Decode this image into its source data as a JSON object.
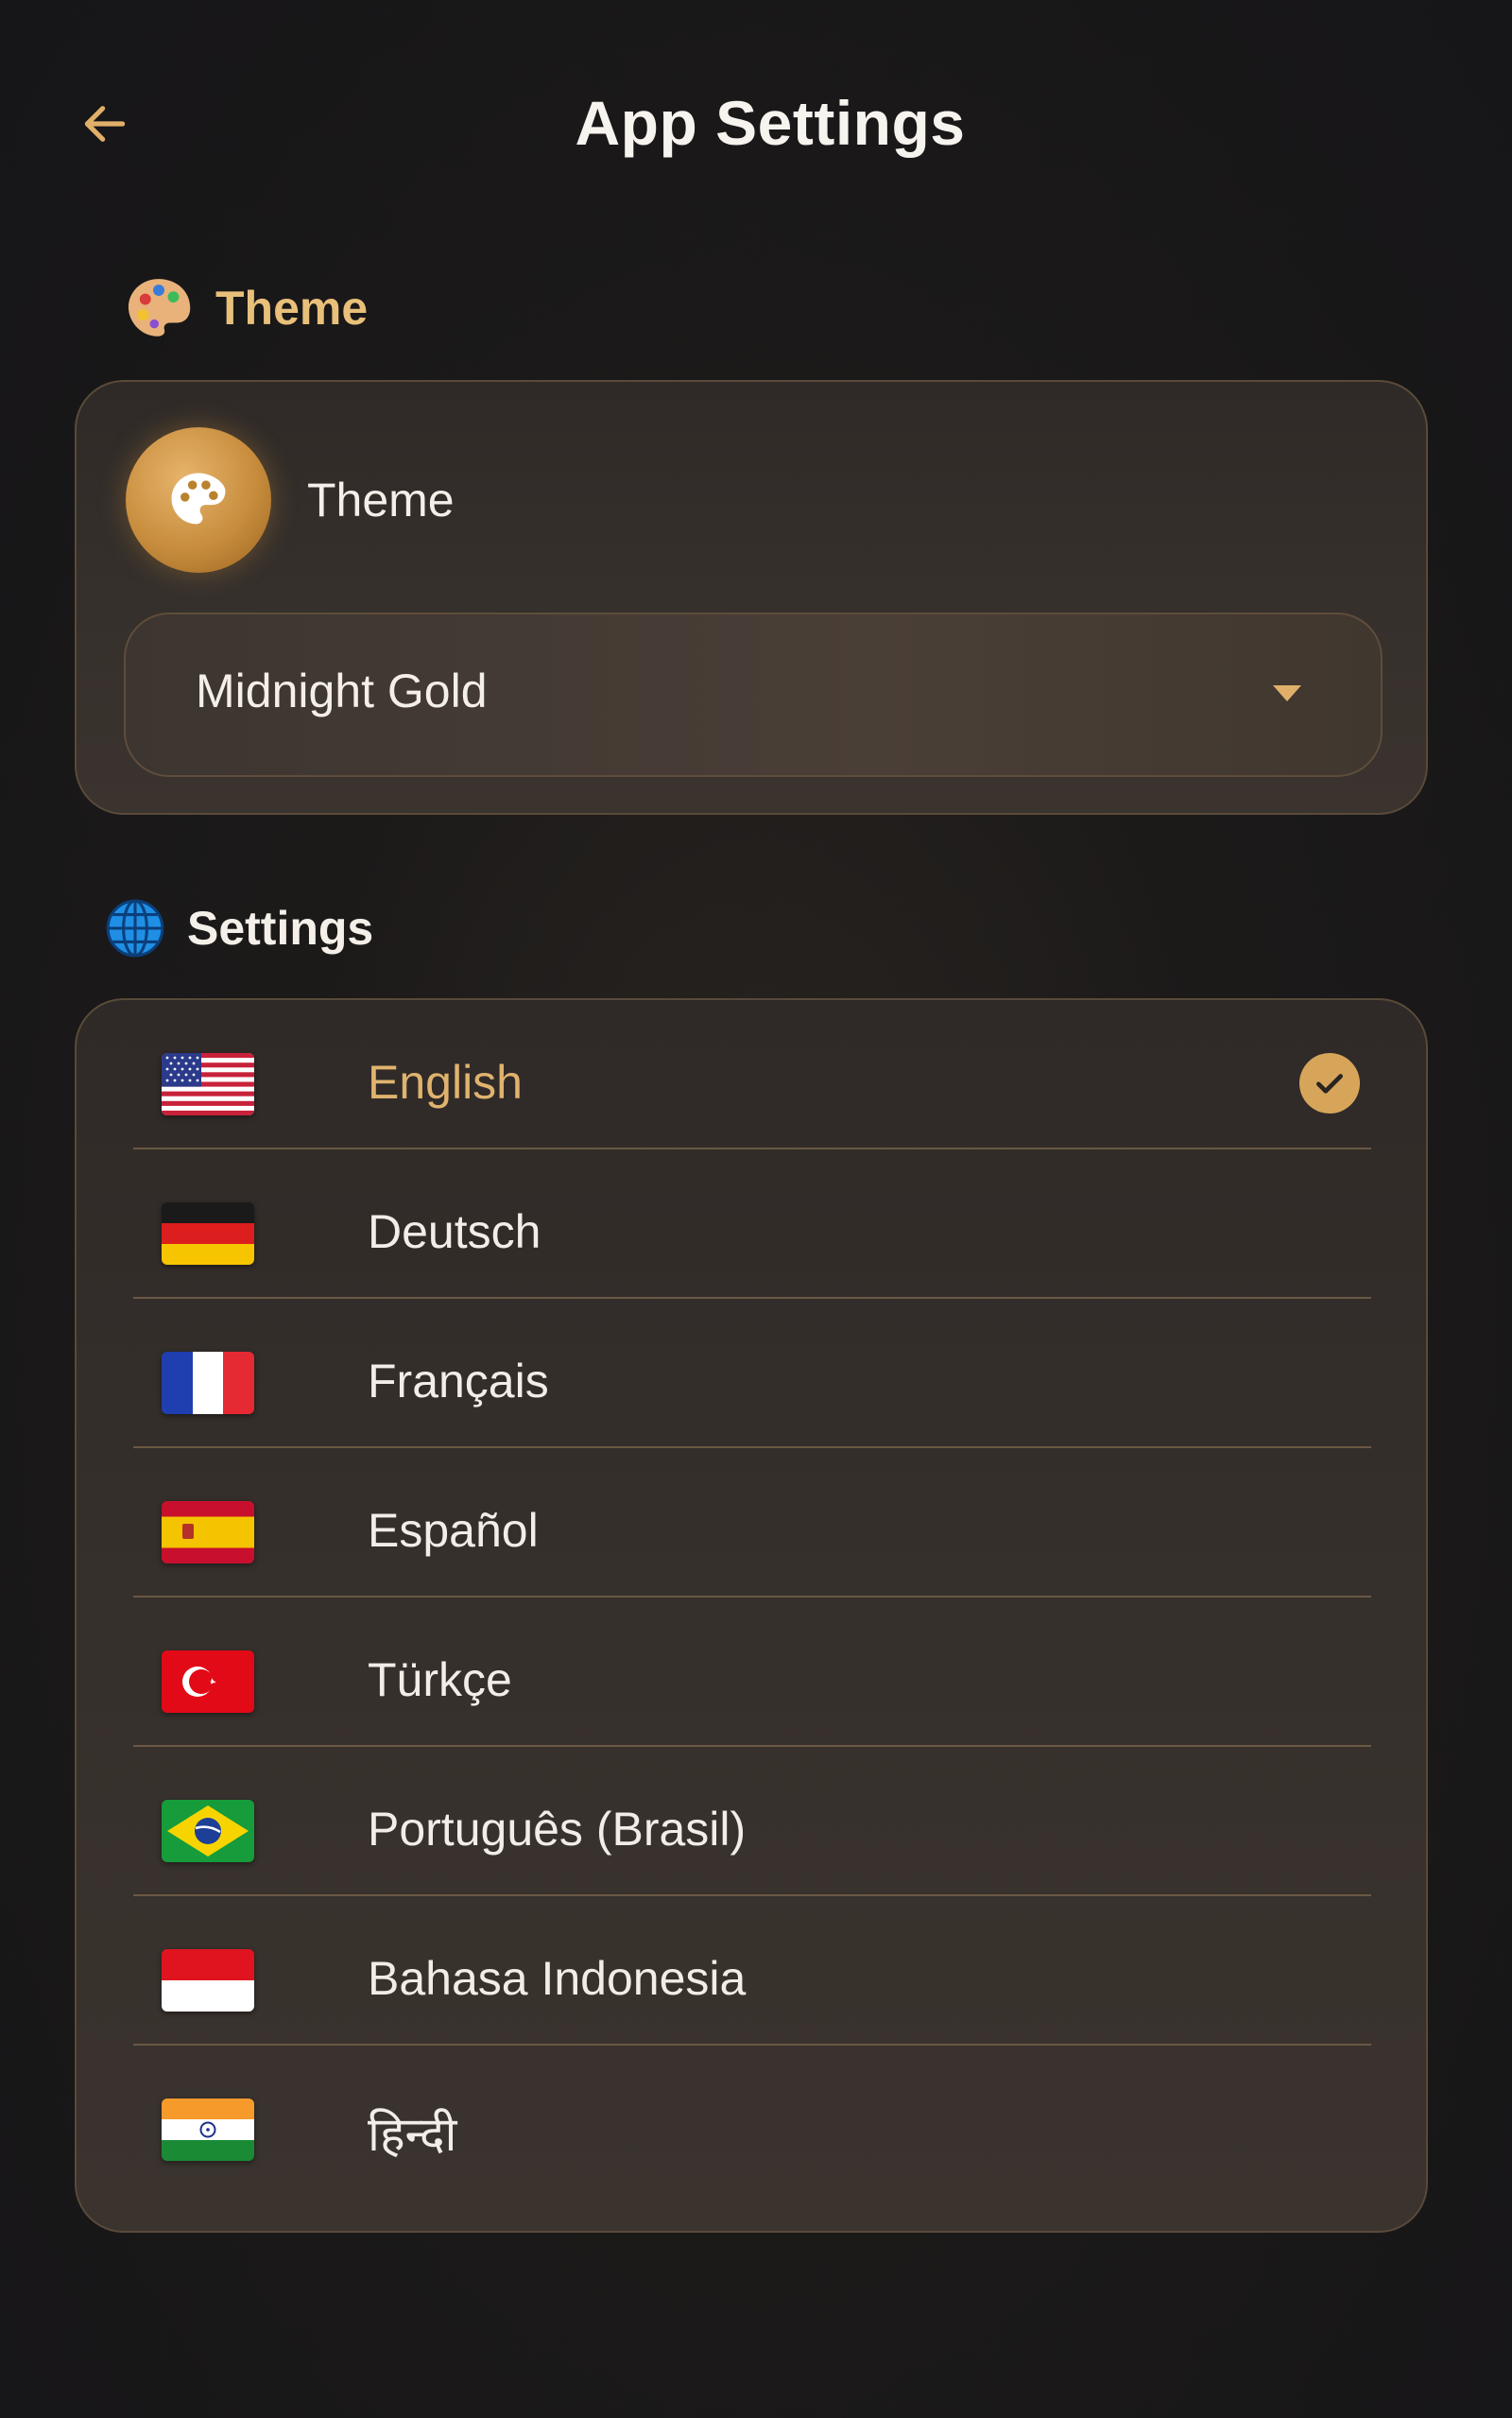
{
  "header": {
    "title": "App Settings",
    "back_icon": "arrow-left-icon"
  },
  "theme_section": {
    "heading": "Theme",
    "heading_icon": "palette-emoji-icon",
    "row_label": "Theme",
    "row_icon": "palette-icon",
    "selected_theme": "Midnight Gold",
    "dropdown_icon": "caret-down-icon"
  },
  "language_section": {
    "heading": "Settings",
    "heading_icon": "globe-icon",
    "selected_index": 0,
    "languages": [
      {
        "name": "English",
        "flag": "us-flag-icon"
      },
      {
        "name": "Deutsch",
        "flag": "de-flag-icon"
      },
      {
        "name": "Français",
        "flag": "fr-flag-icon"
      },
      {
        "name": "Español",
        "flag": "es-flag-icon"
      },
      {
        "name": "Türkçe",
        "flag": "tr-flag-icon"
      },
      {
        "name": "Português (Brasil)",
        "flag": "br-flag-icon"
      },
      {
        "name": "Bahasa Indonesia",
        "flag": "id-flag-icon"
      },
      {
        "name": "हिन्दी",
        "flag": "in-flag-icon"
      }
    ]
  },
  "colors": {
    "accent_gold": "#e0b36e",
    "background": "#1c1a19",
    "card_border": "#5a4a3a"
  }
}
